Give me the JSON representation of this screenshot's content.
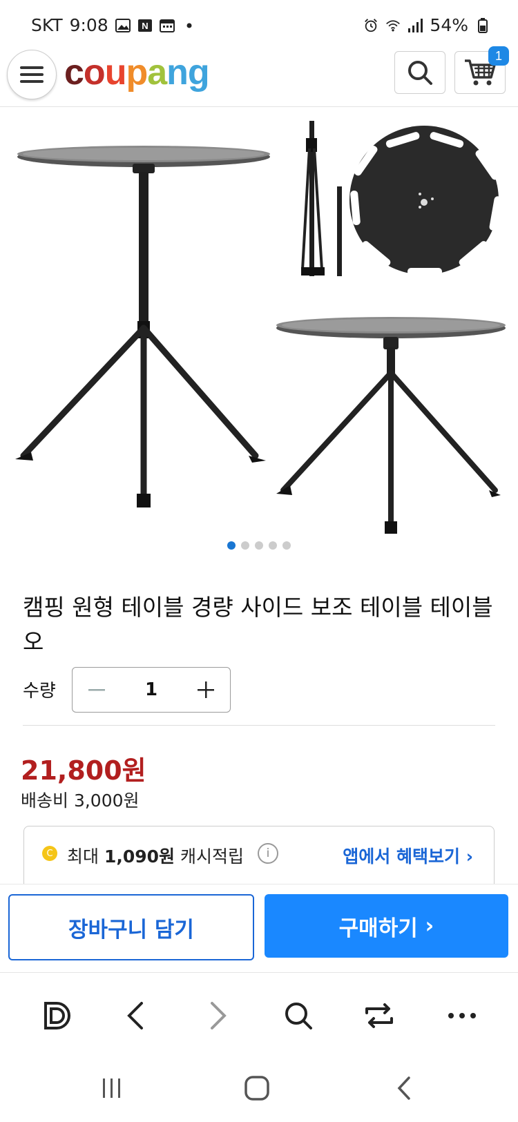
{
  "status_bar": {
    "carrier": "SKT",
    "time": "9:08",
    "battery": "54%"
  },
  "header": {
    "logo": [
      "c",
      "o",
      "u",
      "p",
      "a",
      "n",
      "g"
    ],
    "logo_colors": [
      "#6b1f1f",
      "#c4302b",
      "#e8442e",
      "#f08c2a",
      "#a1c23c",
      "#3fa4dd",
      "#3fa4dd"
    ],
    "cart_count": "1"
  },
  "product": {
    "image_count": 5,
    "active_image": 1,
    "title": "캠핑 원형 테이블 경량 사이드 보조 테이블 테이블오",
    "quantity_label": "수량",
    "quantity": "1",
    "price": "21,800원",
    "shipping": "배송비 3,000원"
  },
  "cashback": {
    "coin": "C",
    "prefix": "최대 ",
    "amount": "1,090원",
    "suffix": " 캐시적립",
    "link": "앱에서 혜택보기"
  },
  "actions": {
    "add_to_cart": "장바구니 담기",
    "buy_now": "구매하기"
  },
  "colors": {
    "brand_blue": "#1a88ff",
    "link_blue": "#1a66d6",
    "price_red": "#b21f1f"
  }
}
